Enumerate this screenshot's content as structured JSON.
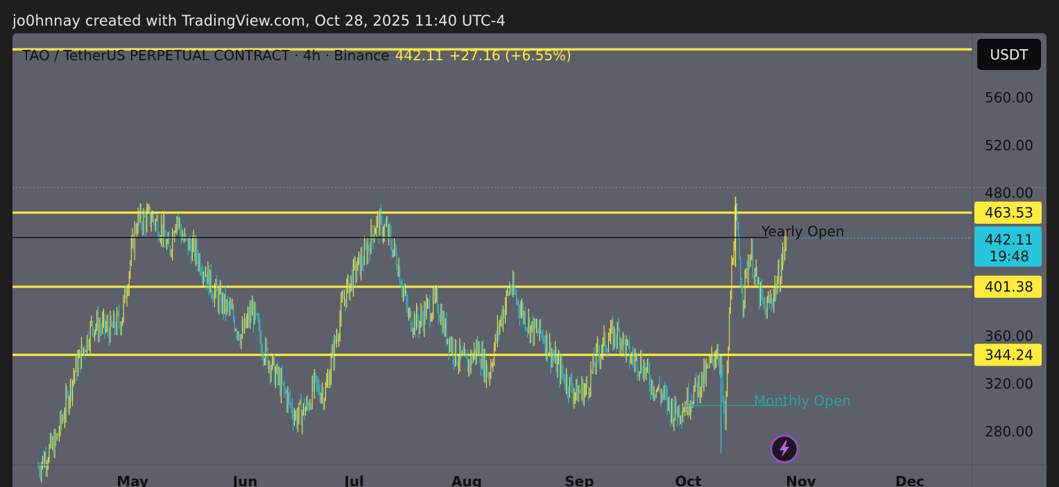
{
  "caption": "jo0hnnay created with TradingView.com, Oct 28, 2025 11:40 UTC-4",
  "header": {
    "symbol": "TAO / TetherUS PERPETUAL CONTRACT · 4h · Binance",
    "price": "442.11",
    "change": "+27.16 (+6.55%)",
    "currency_button": "USDT"
  },
  "colors": {
    "background": "#5d606b",
    "level_line": "#ffeb3b",
    "candle_up": "#ffeb3b",
    "candle_down": "#26c6da",
    "current_price_badge": "#26c6da",
    "monthly_open": "#26a69a",
    "lightning_button": "#b040e0"
  },
  "icons": {
    "lightning": "lightning-icon"
  },
  "chart_data": {
    "type": "line",
    "title": "",
    "xlabel": "",
    "ylabel": "",
    "x_ticks": [
      "May",
      "Jun",
      "Jul",
      "Aug",
      "Sep",
      "Oct",
      "Nov",
      "Dec"
    ],
    "y_ticks": [
      "560.00",
      "520.00",
      "480.00",
      "360.00",
      "320.00",
      "280.00"
    ],
    "ylim": [
      252,
      614
    ],
    "grid": false,
    "horizontal_levels": [
      {
        "value": 600.5,
        "label": ""
      },
      {
        "value": 463.53,
        "label": "463.53"
      },
      {
        "value": 401.38,
        "label": "401.38"
      },
      {
        "value": 344.24,
        "label": "344.24"
      }
    ],
    "current_price": {
      "value": 442.11,
      "label": "442.11",
      "countdown": "19:48"
    },
    "annotations": [
      {
        "text": "Yearly Open",
        "value": 442.7,
        "from": "2025-04-01",
        "to": "2025-10-23"
      },
      {
        "text": "Monthly Open",
        "value": 301.7,
        "from": "2025-09-30",
        "to": "2025-10-28"
      }
    ],
    "series": [
      {
        "x": [
          "2025-04-05",
          "2025-04-10",
          "2025-04-15",
          "2025-04-20",
          "2025-04-25",
          "2025-04-28",
          "2025-05-02",
          "2025-05-06",
          "2025-05-09",
          "2025-05-11",
          "2025-05-13",
          "2025-05-15",
          "2025-05-18",
          "2025-05-21",
          "2025-05-23",
          "2025-05-25",
          "2025-05-28",
          "2025-05-31",
          "2025-06-03",
          "2025-06-06",
          "2025-06-09",
          "2025-06-12",
          "2025-06-15",
          "2025-06-18",
          "2025-06-20",
          "2025-06-23",
          "2025-06-25",
          "2025-06-28",
          "2025-07-01",
          "2025-07-04",
          "2025-07-07",
          "2025-07-10",
          "2025-07-13",
          "2025-07-16",
          "2025-07-19",
          "2025-07-21",
          "2025-07-24",
          "2025-07-26",
          "2025-07-29",
          "2025-08-01",
          "2025-08-04",
          "2025-08-07",
          "2025-08-10",
          "2025-08-13",
          "2025-08-16",
          "2025-08-19",
          "2025-08-22",
          "2025-08-25",
          "2025-08-28",
          "2025-08-31",
          "2025-09-03",
          "2025-09-06",
          "2025-09-09",
          "2025-09-12",
          "2025-09-15",
          "2025-09-18",
          "2025-09-21",
          "2025-09-24",
          "2025-09-27",
          "2025-09-30",
          "2025-10-03",
          "2025-10-06",
          "2025-10-09",
          "2025-10-10",
          "2025-10-11",
          "2025-10-13",
          "2025-10-14",
          "2025-10-16",
          "2025-10-18",
          "2025-10-20",
          "2025-10-22",
          "2025-10-24",
          "2025-10-26",
          "2025-10-28"
        ],
        "y": [
          250,
          272,
          330,
          370,
          365,
          375,
          455,
          460,
          450,
          430,
          462,
          440,
          432,
          415,
          400,
          390,
          380,
          360,
          382,
          350,
          330,
          312,
          292,
          300,
          318,
          312,
          342,
          390,
          413,
          428,
          455,
          448,
          422,
          375,
          372,
          382,
          388,
          365,
          345,
          335,
          350,
          328,
          370,
          402,
          382,
          365,
          362,
          340,
          325,
          312,
          316,
          345,
          358,
          362,
          342,
          338,
          320,
          310,
          296,
          302,
          315,
          328,
          350,
          335,
          278,
          422,
          460,
          392,
          432,
          402,
          380,
          392,
          410,
          442
        ]
      }
    ]
  }
}
